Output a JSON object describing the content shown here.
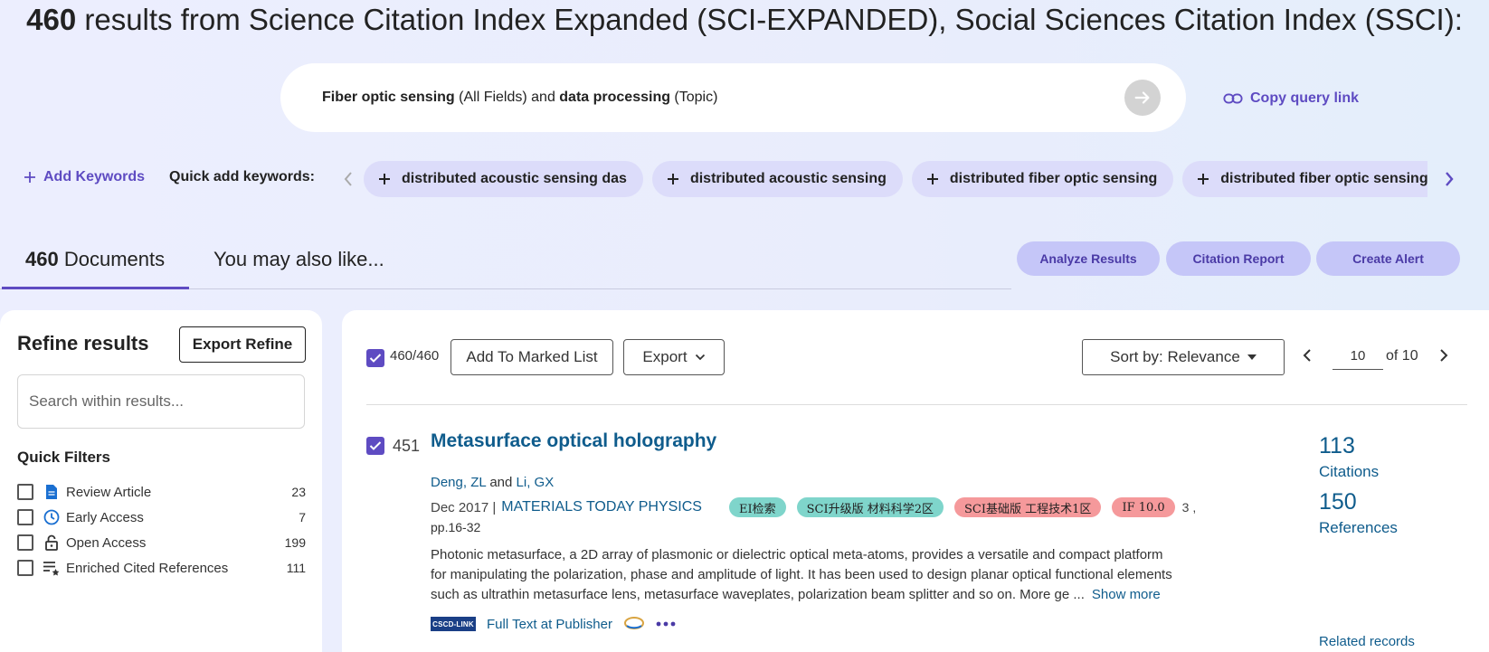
{
  "headline": {
    "count": "460",
    "text": " results from Science Citation Index Expanded (SCI-EXPANDED), Social Sciences Citation Index (SSCI):"
  },
  "query": {
    "term1": "Fiber optic sensing",
    "field1": " (All Fields) and ",
    "term2": "data processing",
    "field2": " (Topic)"
  },
  "copy_query_link": "Copy query link",
  "keywords": {
    "add_label": "Add Keywords",
    "quick_label": "Quick add keywords:",
    "chips": [
      "distributed acoustic sensing das",
      "distributed acoustic sensing",
      "distributed fiber optic sensing",
      "distributed fiber optic sensing"
    ]
  },
  "tabs": {
    "documents_count": "460",
    "documents_label": " Documents",
    "also_like": "You may also like..."
  },
  "actions": {
    "analyze": "Analyze Results",
    "citation_report": "Citation Report",
    "create_alert": "Create Alert"
  },
  "refine": {
    "title": "Refine results",
    "export_label": "Export Refine",
    "search_placeholder": "Search within results...",
    "quick_filters_title": "Quick Filters",
    "filters": [
      {
        "label": "Review Article",
        "count": "23",
        "icon": "document-icon"
      },
      {
        "label": "Early Access",
        "count": "7",
        "icon": "clock-icon"
      },
      {
        "label": "Open Access",
        "count": "199",
        "icon": "unlock-icon"
      },
      {
        "label": "Enriched Cited References",
        "count": "111",
        "icon": "list-star-icon"
      }
    ]
  },
  "toolbar": {
    "selected": "460/460",
    "add_marked": "Add To Marked List",
    "export": "Export",
    "sort": "Sort by: Relevance",
    "page_value": "10",
    "page_of": "of 10"
  },
  "record": {
    "number": "451",
    "title": "Metasurface optical holography",
    "author1": "Deng, ZL",
    "author_sep": " and ",
    "author2": "Li, GX",
    "date": "Dec 2017 | ",
    "journal": "MATERIALS TODAY PHYSICS",
    "badges": [
      {
        "text": "EI检索",
        "color": "#7fd5cb"
      },
      {
        "text": "SCI升级版 材料科学2区",
        "color": "#7fd5cb"
      },
      {
        "text": "SCI基础版 工程技术1区",
        "color": "#f5999b"
      },
      {
        "text": "IF 10.0",
        "color": "#f5999b"
      }
    ],
    "volume": "3 ,",
    "pages": "pp.16-32",
    "abstract": "Photonic metasurface, a 2D array of plasmonic or dielectric optical meta-atoms, provides a versatile and compact platform for manipulating the polarization, phase and amplitude of light. It has been used to design planar optical functional elements such as ultrathin metasurface lens, metasurface waveplates, polarization beam splitter and so on. More ge ...",
    "show_more": "Show more",
    "cscd_label": "CSCD-LINK",
    "full_text": "Full Text at Publisher",
    "citations_count": "113",
    "citations_label": "Citations",
    "references_count": "150",
    "references_label": "References",
    "related": "Related records"
  },
  "colors": {
    "accent": "#5e4bc2",
    "link": "#0f5c8c",
    "chip_bg": "#dcdcfa",
    "action_bg": "#c5c6f8"
  }
}
